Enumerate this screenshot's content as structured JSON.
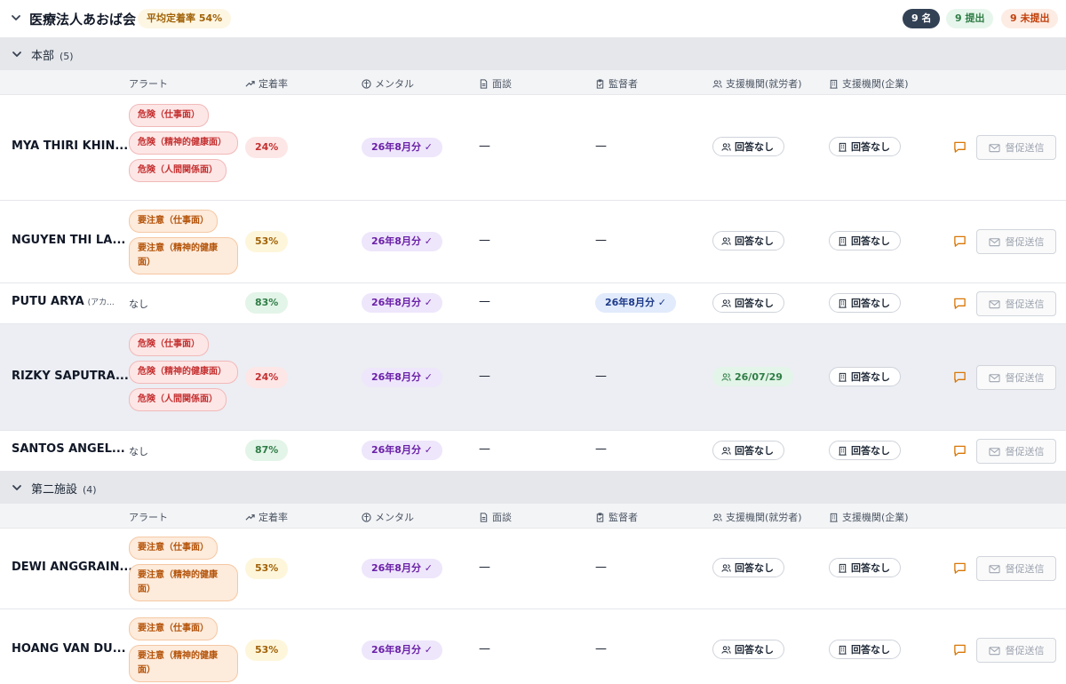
{
  "org": {
    "title": "医療法人あおば会",
    "avg_rate": "平均定着率 54%",
    "total": "9 名",
    "submitted": "9 提出",
    "unsubmitted": "9 未提出"
  },
  "colors": {
    "danger": "#c53030",
    "caution": "#b45309",
    "good": "#2f7d46",
    "mental": "#6b21a8",
    "supervisor": "#1e3a8a",
    "chat_icon": "#d97706"
  },
  "columns": {
    "alert": "アラート",
    "retention": "定着率",
    "mental": "メンタル",
    "interview": "面談",
    "supervisor": "監督者",
    "support_worker": "支援機関(就労者)",
    "support_company": "支援機関(企業)"
  },
  "groups": [
    {
      "name": "本部",
      "count": "(5)",
      "rows": [
        {
          "name": "MYA THIRI KHIN...",
          "alerts": [
            "危険（仕事面）",
            "危険（精神的健康面）",
            "危険（人間関係面）"
          ],
          "rate": "24%",
          "mental": "26年8月分 ✓",
          "interview": "—",
          "supervisor": "—",
          "support_worker": "回答なし",
          "support_company": "回答なし",
          "remind": "督促送信"
        },
        {
          "name": "NGUYEN THI LA...",
          "alerts": [
            "要注意（仕事面）",
            "要注意（精神的健康面）"
          ],
          "rate": "53%",
          "mental": "26年8月分 ✓",
          "interview": "—",
          "supervisor": "—",
          "support_worker": "回答なし",
          "support_company": "回答なし",
          "remind": "督促送信"
        },
        {
          "name": "PUTU ARYA",
          "name_sub": "(アカ...",
          "alert_none": "なし",
          "rate": "83%",
          "mental": "26年8月分 ✓",
          "interview": "—",
          "supervisor": "26年8月分 ✓",
          "support_worker": "回答なし",
          "support_company": "回答なし",
          "remind": "督促送信"
        },
        {
          "name": "RIZKY SAPUTRA...",
          "alerts": [
            "危険（仕事面）",
            "危険（精神的健康面）",
            "危険（人間関係面）"
          ],
          "rate": "24%",
          "mental": "26年8月分 ✓",
          "interview": "—",
          "supervisor": "—",
          "support_worker": "26/07/29",
          "support_company": "回答なし",
          "remind": "督促送信"
        },
        {
          "name": "SANTOS ANGEL...",
          "alert_none": "なし",
          "rate": "87%",
          "mental": "26年8月分 ✓",
          "interview": "—",
          "supervisor": "—",
          "support_worker": "回答なし",
          "support_company": "回答なし",
          "remind": "督促送信"
        }
      ]
    },
    {
      "name": "第二施設",
      "count": "(4)",
      "rows": [
        {
          "name": "DEWI ANGGRAIN...",
          "alerts": [
            "要注意（仕事面）",
            "要注意（精神的健康面）"
          ],
          "rate": "53%",
          "mental": "26年8月分 ✓",
          "interview": "—",
          "supervisor": "—",
          "support_worker": "回答なし",
          "support_company": "回答なし",
          "remind": "督促送信"
        },
        {
          "name": "HOANG VAN DU...",
          "alerts": [
            "要注意（仕事面）",
            "要注意（精神的健康面）"
          ],
          "rate": "53%",
          "mental": "26年8月分 ✓",
          "interview": "—",
          "supervisor": "—",
          "support_worker": "回答なし",
          "support_company": "回答なし",
          "remind": "督促送信"
        }
      ]
    }
  ]
}
